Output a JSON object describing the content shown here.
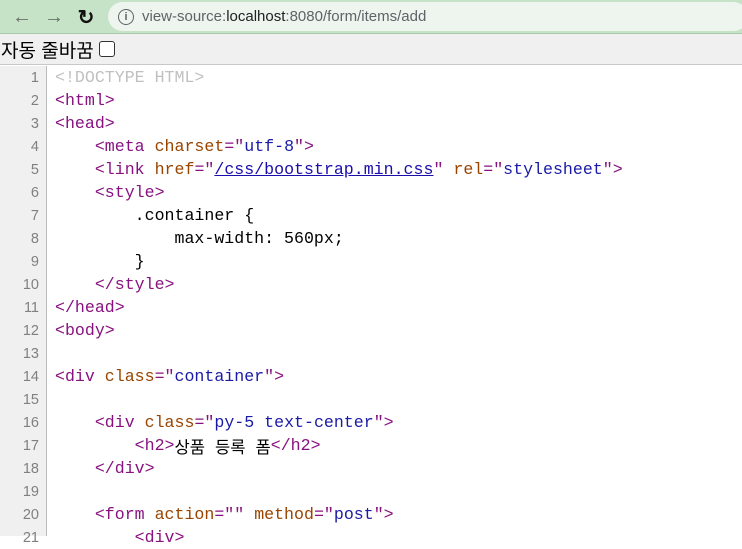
{
  "browser": {
    "url_prefix": "view-source:",
    "url_host": "localhost",
    "url_rest": ":8080/form/items/add"
  },
  "wrap": {
    "label": "자동 줄바꿈",
    "checked": false
  },
  "colors": {
    "tag": "#881280",
    "attr": "#994500",
    "value": "#1a1aa6",
    "doctype": "#c0c0c0"
  },
  "lines": [
    [
      [
        "d",
        "<!DOCTYPE HTML>"
      ]
    ],
    [
      [
        "t",
        "<html>"
      ]
    ],
    [
      [
        "t",
        "<head>"
      ]
    ],
    [
      [
        "x",
        "    "
      ],
      [
        "t",
        "<meta "
      ],
      [
        "a",
        "charset"
      ],
      [
        "t",
        "=\""
      ],
      [
        "v",
        "utf-8"
      ],
      [
        "t",
        "\">"
      ]
    ],
    [
      [
        "x",
        "    "
      ],
      [
        "t",
        "<link "
      ],
      [
        "a",
        "href"
      ],
      [
        "t",
        "=\""
      ],
      [
        "l",
        "/css/bootstrap.min.css"
      ],
      [
        "t",
        "\" "
      ],
      [
        "a",
        "rel"
      ],
      [
        "t",
        "=\""
      ],
      [
        "v",
        "stylesheet"
      ],
      [
        "t",
        "\">"
      ]
    ],
    [
      [
        "x",
        "    "
      ],
      [
        "t",
        "<style>"
      ]
    ],
    [
      [
        "x",
        "        .container {"
      ]
    ],
    [
      [
        "x",
        "            max-width: 560px;"
      ]
    ],
    [
      [
        "x",
        "        }"
      ]
    ],
    [
      [
        "x",
        "    "
      ],
      [
        "t",
        "</style>"
      ]
    ],
    [
      [
        "t",
        "</head>"
      ]
    ],
    [
      [
        "t",
        "<body>"
      ]
    ],
    [],
    [
      [
        "t",
        "<div "
      ],
      [
        "a",
        "class"
      ],
      [
        "t",
        "=\""
      ],
      [
        "v",
        "container"
      ],
      [
        "t",
        "\">"
      ]
    ],
    [],
    [
      [
        "x",
        "    "
      ],
      [
        "t",
        "<div "
      ],
      [
        "a",
        "class"
      ],
      [
        "t",
        "=\""
      ],
      [
        "v",
        "py-5 text-center"
      ],
      [
        "t",
        "\">"
      ]
    ],
    [
      [
        "x",
        "        "
      ],
      [
        "t",
        "<h2>"
      ],
      [
        "x",
        "상품 등록 폼"
      ],
      [
        "t",
        "</h2>"
      ]
    ],
    [
      [
        "x",
        "    "
      ],
      [
        "t",
        "</div>"
      ]
    ],
    [],
    [
      [
        "x",
        "    "
      ],
      [
        "t",
        "<form "
      ],
      [
        "a",
        "action"
      ],
      [
        "t",
        "=\"\" "
      ],
      [
        "a",
        "method"
      ],
      [
        "t",
        "=\""
      ],
      [
        "v",
        "post"
      ],
      [
        "t",
        "\">"
      ]
    ],
    [
      [
        "x",
        "        "
      ],
      [
        "t",
        "<div>"
      ]
    ]
  ]
}
